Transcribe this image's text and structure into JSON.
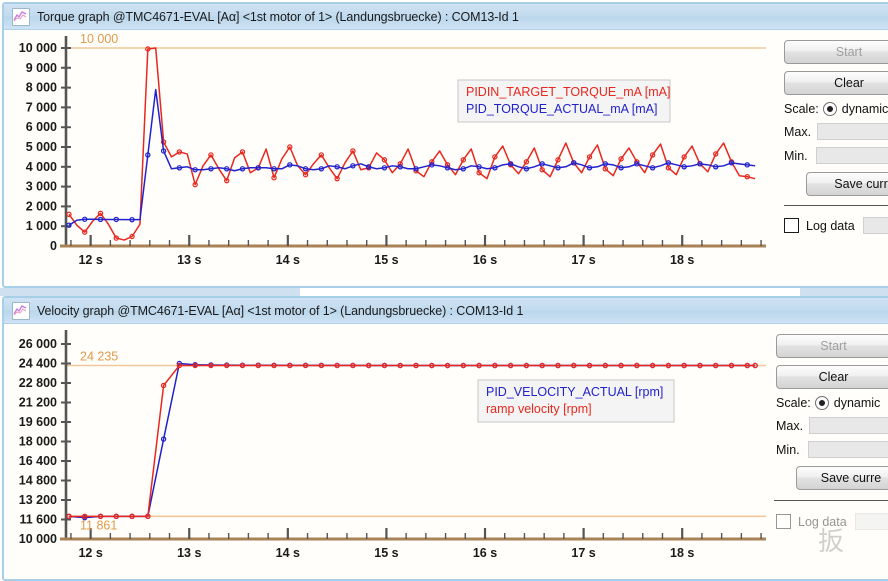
{
  "torque_window": {
    "title": "Torque graph @TMC4671-EVAL [Aα] <1st motor of 1> (Landungsbruecke) : COM13-Id 1",
    "icon": "chart-icon",
    "panel": {
      "start_label": "Start",
      "clear_label": "Clear",
      "scale_label": "Scale:",
      "scale_value": "dynamic",
      "max_label": "Max.",
      "max_value": "",
      "min_label": "Min.",
      "min_value": "",
      "save_label": "Save curr",
      "log_label": "Log data",
      "log_value": ""
    },
    "legend": [
      {
        "text": "PIDIN_TARGET_TORQUE_mA [mA]",
        "color": "#e8281e"
      },
      {
        "text": "PID_TORQUE_ACTUAL_mA [mA]",
        "color": "#2222cc"
      }
    ],
    "marker_labels": [
      "10 000"
    ]
  },
  "velocity_window": {
    "title": "Velocity graph @TMC4671-EVAL [Aα] <1st motor of 1> (Landungsbruecke) : COM13-Id 1",
    "icon": "chart-icon",
    "panel": {
      "start_label": "Start",
      "clear_label": "Clear",
      "scale_label": "Scale:",
      "scale_value": "dynamic",
      "max_label": "Max.",
      "max_value": "",
      "min_label": "Min.",
      "min_value": "",
      "save_label": "Save curre",
      "log_label": "Log data",
      "log_value": ""
    },
    "legend": [
      {
        "text": "PID_VELOCITY_ACTUAL [rpm]",
        "color": "#2222cc"
      },
      {
        "text": "ramp velocity [rpm]",
        "color": "#e8281e"
      }
    ],
    "marker_labels": [
      "24 235",
      "11 861"
    ]
  },
  "watermark_text": "扳",
  "colors": {
    "red": "#e8281e",
    "blue": "#2222cc",
    "marker_orange": "#f0a860",
    "marker_text": "#e09a4a",
    "axis": "#a98355",
    "tick": "#555555",
    "titlebar": "#c3dbef",
    "border": "#a8cfe8"
  },
  "chart_data": [
    {
      "type": "line",
      "title": "Torque graph",
      "xlabel": "",
      "ylabel": "",
      "xlim": [
        11.75,
        18.85
      ],
      "ylim": [
        0,
        10000
      ],
      "yticks": [
        0,
        1000,
        2000,
        3000,
        4000,
        5000,
        6000,
        7000,
        8000,
        9000,
        10000
      ],
      "ytick_labels": [
        "0",
        "1 000",
        "2 000",
        "3 000",
        "4 000",
        "5 000",
        "6 000",
        "7 000",
        "8 000",
        "9 000",
        "10 000"
      ],
      "xticks": [
        12,
        13,
        14,
        15,
        16,
        17,
        18
      ],
      "xtick_labels": [
        "12 s",
        "13 s",
        "14 s",
        "15 s",
        "16 s",
        "17 s",
        "18 s"
      ],
      "grid": false,
      "legend_position": "upper-right",
      "hlines": [
        {
          "value": 10000,
          "label": "10 000",
          "color": "#f0c89a"
        }
      ],
      "x": [
        11.78,
        11.86,
        11.94,
        12.02,
        12.1,
        12.18,
        12.26,
        12.34,
        12.42,
        12.5,
        12.58,
        12.66,
        12.74,
        12.82,
        12.9,
        12.98,
        13.06,
        13.14,
        13.22,
        13.3,
        13.38,
        13.46,
        13.54,
        13.62,
        13.7,
        13.78,
        13.86,
        13.94,
        14.02,
        14.1,
        14.18,
        14.26,
        14.34,
        14.42,
        14.5,
        14.58,
        14.66,
        14.74,
        14.82,
        14.9,
        14.98,
        15.06,
        15.14,
        15.22,
        15.3,
        15.38,
        15.46,
        15.54,
        15.62,
        15.7,
        15.78,
        15.86,
        15.94,
        16.02,
        16.1,
        16.18,
        16.26,
        16.34,
        16.42,
        16.5,
        16.58,
        16.66,
        16.74,
        16.82,
        16.9,
        16.98,
        17.06,
        17.14,
        17.22,
        17.3,
        17.38,
        17.46,
        17.54,
        17.62,
        17.7,
        17.78,
        17.86,
        17.94,
        18.02,
        18.1,
        18.18,
        18.26,
        18.34,
        18.42,
        18.5,
        18.58,
        18.66,
        18.74
      ],
      "series": [
        {
          "name": "PIDIN_TARGET_TORQUE_mA [mA]",
          "color": "#e8281e",
          "values": [
            1600,
            1050,
            700,
            1250,
            1650,
            1100,
            400,
            300,
            480,
            1100,
            9950,
            10000,
            5250,
            4500,
            4750,
            4650,
            3100,
            4050,
            4600,
            3900,
            3300,
            4450,
            4750,
            3700,
            3950,
            4900,
            3450,
            4400,
            5000,
            4050,
            3600,
            4150,
            4600,
            3950,
            3400,
            4200,
            4800,
            3850,
            3950,
            4700,
            4350,
            3700,
            4150,
            4900,
            3800,
            3500,
            4250,
            4800,
            4100,
            3600,
            4350,
            4900,
            3700,
            3400,
            4500,
            5050,
            4100,
            3650,
            4250,
            4950,
            3850,
            3500,
            4350,
            5200,
            4200,
            3700,
            4500,
            5100,
            3900,
            3550,
            4400,
            4950,
            4250,
            3700,
            4600,
            5150,
            3950,
            3600,
            4500,
            5050,
            4150,
            3750,
            4650,
            5200,
            4250,
            3550,
            3500,
            3400
          ]
        },
        {
          "name": "PID_TORQUE_ACTUAL_mA [mA]",
          "color": "#2222cc",
          "values": [
            1050,
            1300,
            1350,
            1350,
            1340,
            1340,
            1340,
            1330,
            1330,
            1330,
            4600,
            7900,
            4800,
            3900,
            3950,
            4000,
            3850,
            3850,
            3900,
            3950,
            3900,
            3800,
            3900,
            3950,
            3950,
            3950,
            3900,
            3900,
            4100,
            4050,
            3900,
            3850,
            3900,
            4050,
            4000,
            3900,
            4050,
            4150,
            4000,
            3900,
            3950,
            4050,
            4000,
            3900,
            3900,
            4000,
            4100,
            4050,
            3950,
            3850,
            3900,
            4050,
            4000,
            3900,
            3950,
            4100,
            4150,
            4000,
            3900,
            4000,
            4150,
            4050,
            3950,
            4000,
            4200,
            4100,
            3950,
            4000,
            4150,
            4100,
            3950,
            4000,
            4150,
            4050,
            3950,
            4050,
            4200,
            4100,
            4000,
            4050,
            4150,
            4100,
            4000,
            4050,
            4200,
            4150,
            4100,
            4050
          ]
        }
      ]
    },
    {
      "type": "line",
      "title": "Velocity graph",
      "xlabel": "",
      "ylabel": "",
      "xlim": [
        11.75,
        18.85
      ],
      "ylim": [
        10000,
        26000
      ],
      "yticks": [
        10000,
        11600,
        13200,
        14800,
        16400,
        18000,
        19600,
        21200,
        22800,
        24400,
        26000
      ],
      "ytick_labels": [
        "10 000",
        "11 600",
        "13 200",
        "14 800",
        "16 400",
        "18 000",
        "19 600",
        "21 200",
        "22 800",
        "24 400",
        "26 000"
      ],
      "xticks": [
        12,
        13,
        14,
        15,
        16,
        17,
        18
      ],
      "xtick_labels": [
        "12 s",
        "13 s",
        "14 s",
        "15 s",
        "16 s",
        "17 s",
        "18 s"
      ],
      "grid": false,
      "legend_position": "center-right",
      "hlines": [
        {
          "value": 24235,
          "label": "24 235",
          "color": "#f0c89a"
        },
        {
          "value": 11861,
          "label": "11 861",
          "color": "#f0c89a"
        }
      ],
      "x": [
        11.78,
        11.94,
        12.1,
        12.26,
        12.42,
        12.58,
        12.74,
        12.9,
        13.06,
        13.22,
        13.38,
        13.54,
        13.7,
        13.86,
        14.02,
        14.18,
        14.34,
        14.5,
        14.66,
        14.82,
        14.98,
        15.14,
        15.3,
        15.46,
        15.62,
        15.78,
        15.94,
        16.1,
        16.26,
        16.42,
        16.58,
        16.74,
        16.9,
        17.06,
        17.22,
        17.38,
        17.54,
        17.7,
        17.86,
        18.02,
        18.18,
        18.34,
        18.5,
        18.66,
        18.74
      ],
      "series": [
        {
          "name": "PID_VELOCITY_ACTUAL [rpm]",
          "color": "#2222cc",
          "values": [
            11861,
            11750,
            11861,
            11861,
            11861,
            11861,
            18200,
            24400,
            24300,
            24280,
            24270,
            24260,
            24260,
            24255,
            24250,
            24250,
            24250,
            24245,
            24245,
            24240,
            24240,
            24240,
            24240,
            24235,
            24235,
            24235,
            24235,
            24235,
            24235,
            24235,
            24235,
            24235,
            24235,
            24235,
            24235,
            24235,
            24235,
            24235,
            24235,
            24235,
            24235,
            24235,
            24235,
            24235,
            24235
          ]
        },
        {
          "name": "ramp velocity [rpm]",
          "color": "#e8281e",
          "values": [
            11861,
            11861,
            11861,
            11861,
            11861,
            11861,
            22600,
            24235,
            24235,
            24235,
            24235,
            24235,
            24235,
            24235,
            24235,
            24235,
            24235,
            24235,
            24235,
            24235,
            24235,
            24235,
            24235,
            24235,
            24235,
            24235,
            24235,
            24235,
            24235,
            24235,
            24235,
            24235,
            24235,
            24235,
            24235,
            24235,
            24235,
            24235,
            24235,
            24235,
            24235,
            24235,
            24235,
            24235,
            24235
          ]
        }
      ]
    }
  ]
}
